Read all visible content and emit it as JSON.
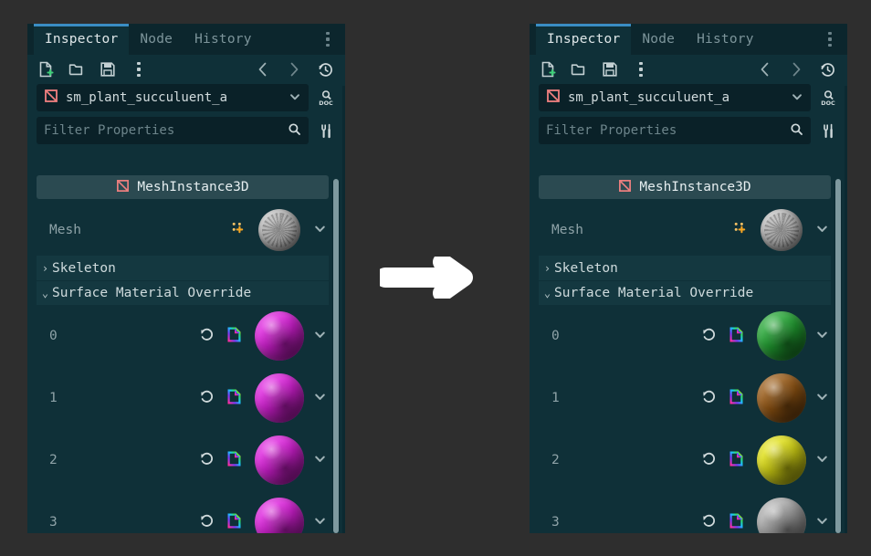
{
  "app": "Godot Editor Inspector",
  "background_color": "#2e2e2e",
  "accent_color": "#3a8dc4",
  "arrow": {
    "name": "transform-arrow",
    "direction": "right",
    "color": "#ffffff"
  },
  "panels": [
    {
      "id": "before",
      "tabs": [
        {
          "label": "Inspector",
          "active": true
        },
        {
          "label": "Node",
          "active": false
        },
        {
          "label": "History",
          "active": false
        }
      ],
      "tab_menu": "tab-overflow-menu",
      "toolbar": {
        "icons": [
          "new-resource-icon",
          "open-folder-icon",
          "save-icon",
          "more-options-icon"
        ],
        "nav": [
          "history-back-icon",
          "history-forward-icon",
          "history-clock-icon"
        ]
      },
      "node_selector": {
        "icon": "meshinstance3d-icon",
        "value": "sm_plant_succuluent_a",
        "dropdown": "chevron-down-icon",
        "side_button": "open-documentation-icon"
      },
      "filter": {
        "placeholder": "Filter Properties",
        "value": "",
        "search_icon": "search-icon",
        "side_button": "object-tools-icon"
      },
      "class_header": {
        "icon": "meshinstance3d-icon",
        "label": "MeshInstance3D"
      },
      "mesh_row": {
        "label": "Mesh",
        "keyframe_icon": "animation-key-icon",
        "preview": "mesh-preview-thumbnail",
        "dropdown": "chevron-down-icon"
      },
      "sections": [
        {
          "label": "Skeleton",
          "expanded": false,
          "arrow": "chevron-right-icon"
        },
        {
          "label": "Surface Material Override",
          "expanded": true,
          "arrow": "chevron-down-icon"
        }
      ],
      "materials": [
        {
          "index": "0",
          "color": "#e020e0",
          "revert_icon": "revert-icon",
          "resource_icon": "resource-file-icon",
          "dropdown": "chevron-down-icon"
        },
        {
          "index": "1",
          "color": "#e020e0",
          "revert_icon": "revert-icon",
          "resource_icon": "resource-file-icon",
          "dropdown": "chevron-down-icon"
        },
        {
          "index": "2",
          "color": "#e020e0",
          "revert_icon": "revert-icon",
          "resource_icon": "resource-file-icon",
          "dropdown": "chevron-down-icon"
        },
        {
          "index": "3",
          "color": "#e020e0",
          "revert_icon": "revert-icon",
          "resource_icon": "resource-file-icon",
          "dropdown": "chevron-down-icon"
        }
      ]
    },
    {
      "id": "after",
      "tabs": [
        {
          "label": "Inspector",
          "active": true
        },
        {
          "label": "Node",
          "active": false
        },
        {
          "label": "History",
          "active": false
        }
      ],
      "tab_menu": "tab-overflow-menu",
      "toolbar": {
        "icons": [
          "new-resource-icon",
          "open-folder-icon",
          "save-icon",
          "more-options-icon"
        ],
        "nav": [
          "history-back-icon",
          "history-forward-icon",
          "history-clock-icon"
        ]
      },
      "node_selector": {
        "icon": "meshinstance3d-icon",
        "value": "sm_plant_succuluent_a",
        "dropdown": "chevron-down-icon",
        "side_button": "open-documentation-icon"
      },
      "filter": {
        "placeholder": "Filter Properties",
        "value": "",
        "search_icon": "search-icon",
        "side_button": "object-tools-icon"
      },
      "class_header": {
        "icon": "meshinstance3d-icon",
        "label": "MeshInstance3D"
      },
      "mesh_row": {
        "label": "Mesh",
        "keyframe_icon": "animation-key-icon",
        "preview": "mesh-preview-thumbnail",
        "dropdown": "chevron-down-icon"
      },
      "sections": [
        {
          "label": "Skeleton",
          "expanded": false,
          "arrow": "chevron-right-icon"
        },
        {
          "label": "Surface Material Override",
          "expanded": true,
          "arrow": "chevron-down-icon"
        }
      ],
      "materials": [
        {
          "index": "0",
          "color": "#23a834",
          "revert_icon": "revert-icon",
          "resource_icon": "resource-file-icon",
          "dropdown": "chevron-down-icon"
        },
        {
          "index": "1",
          "color": "#9a5a14",
          "revert_icon": "revert-icon",
          "resource_icon": "resource-file-icon",
          "dropdown": "chevron-down-icon"
        },
        {
          "index": "2",
          "color": "#e2e215",
          "revert_icon": "revert-icon",
          "resource_icon": "resource-file-icon",
          "dropdown": "chevron-down-icon"
        },
        {
          "index": "3",
          "color": "#aeaeae",
          "revert_icon": "revert-icon",
          "resource_icon": "resource-file-icon",
          "dropdown": "chevron-down-icon"
        }
      ]
    }
  ]
}
